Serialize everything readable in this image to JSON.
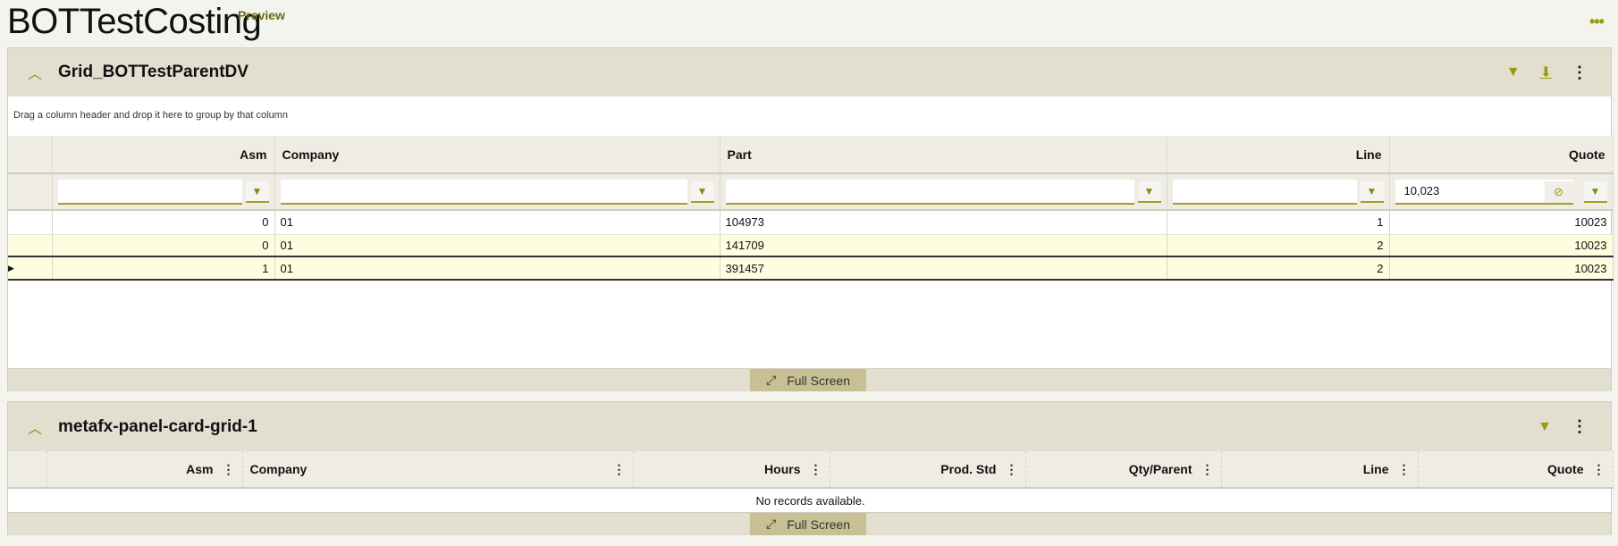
{
  "page": {
    "title": "BOTTestCosting",
    "badge": "Preview"
  },
  "panel1": {
    "title": "Grid_BOTTestParentDV",
    "group_hint": "Drag a column header and drop it here to group by that column",
    "columns": [
      "Asm",
      "Company",
      "Part",
      "Line",
      "Quote"
    ],
    "filters": [
      "",
      "",
      "",
      "",
      "10,023"
    ],
    "rows": [
      [
        "0",
        "01",
        "104973",
        "1",
        "10023"
      ],
      [
        "0",
        "01",
        "141709",
        "2",
        "10023"
      ],
      [
        "1",
        "01",
        "391457",
        "2",
        "10023"
      ]
    ],
    "fullscreen": "Full Screen"
  },
  "panel2": {
    "title": "metafx-panel-card-grid-1",
    "columns": [
      "Asm",
      "Company",
      "Hours",
      "Prod. Std",
      "Qty/Parent",
      "Line",
      "Quote"
    ],
    "empty": "No records available.",
    "fullscreen": "Full Screen"
  },
  "colors": {
    "accent": "#9a9a0c",
    "header": "#e2dfd0",
    "selected_row": "#fffde0"
  }
}
